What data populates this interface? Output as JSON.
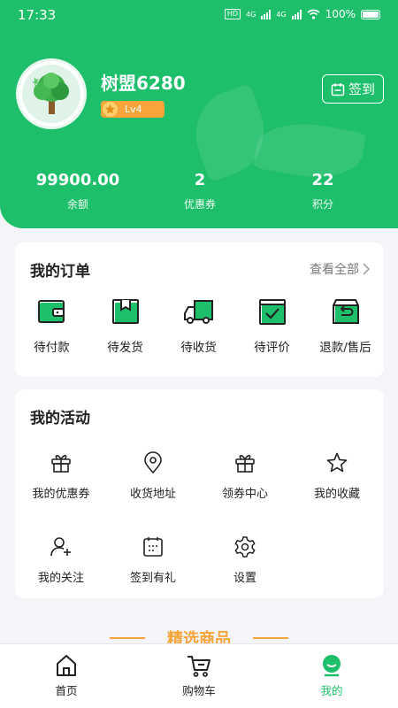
{
  "status_bar": {
    "time": "17:33",
    "network_a": "4G",
    "network_b": "4G",
    "hd": "HD",
    "battery": "100%"
  },
  "profile": {
    "username": "树盟6280",
    "level": "Lv4",
    "checkin_label": "签到"
  },
  "stats": [
    {
      "value": "99900.00",
      "label": "余额"
    },
    {
      "value": "2",
      "label": "优惠券"
    },
    {
      "value": "22",
      "label": "积分"
    }
  ],
  "orders": {
    "title": "我的订单",
    "see_all": "查看全部",
    "items": [
      {
        "label": "待付款",
        "icon": "wallet-icon"
      },
      {
        "label": "待发货",
        "icon": "package-icon"
      },
      {
        "label": "待收货",
        "icon": "truck-icon"
      },
      {
        "label": "待评价",
        "icon": "review-check-icon"
      },
      {
        "label": "退款/售后",
        "icon": "return-box-icon"
      }
    ]
  },
  "activities": {
    "title": "我的活动",
    "items": [
      {
        "label": "我的优惠券",
        "icon": "gift-icon"
      },
      {
        "label": "收货地址",
        "icon": "location-pin-icon"
      },
      {
        "label": "领券中心",
        "icon": "gift-icon"
      },
      {
        "label": "我的收藏",
        "icon": "star-icon"
      },
      {
        "label": "我的关注",
        "icon": "user-add-icon"
      },
      {
        "label": "签到有礼",
        "icon": "calendar-icon"
      },
      {
        "label": "设置",
        "icon": "gear-icon"
      }
    ]
  },
  "featured": {
    "title": "精选商品"
  },
  "tabbar": [
    {
      "label": "首页",
      "icon": "home-icon",
      "active": false
    },
    {
      "label": "购物车",
      "icon": "cart-icon",
      "active": false
    },
    {
      "label": "我的",
      "icon": "profile-icon",
      "active": true
    }
  ],
  "colors": {
    "brand": "#1ebf6a",
    "accent": "#f7a53a",
    "background": "#f3f5f8"
  }
}
